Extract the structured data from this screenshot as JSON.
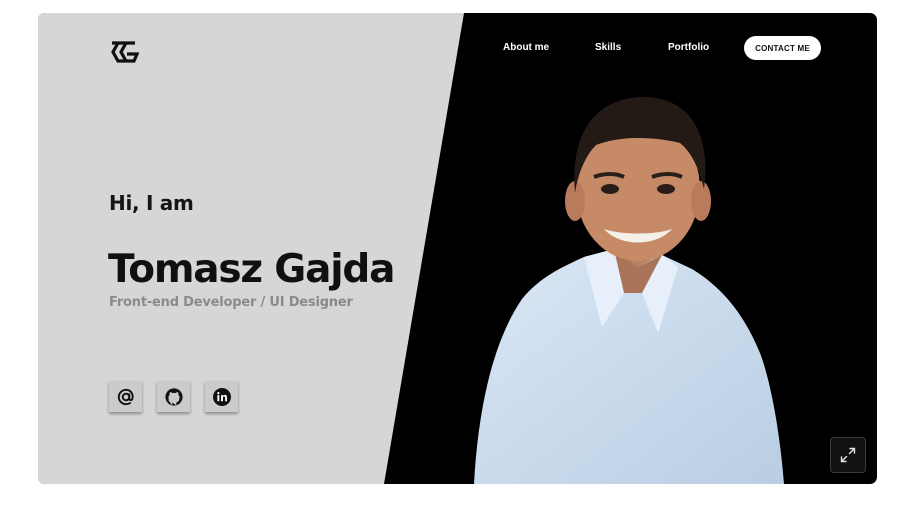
{
  "nav": {
    "links": [
      "About me",
      "Skills",
      "Portfolio"
    ],
    "contact_label": "CONTACT ME"
  },
  "hero": {
    "greeting": "Hi, I am",
    "name": "Tomasz Gajda",
    "role": "Front-end Developer / UI Designer"
  },
  "social": [
    "email-icon",
    "github-icon",
    "linkedin-icon"
  ],
  "icons": {
    "logo": "tg-monogram-logo",
    "expand": "expand-icon"
  },
  "colors": {
    "left_panel": "#d6d6d6",
    "right_panel": "#000000",
    "heading": "#101010",
    "subtitle": "#8a8a8a",
    "button_bg": "#ffffff"
  }
}
